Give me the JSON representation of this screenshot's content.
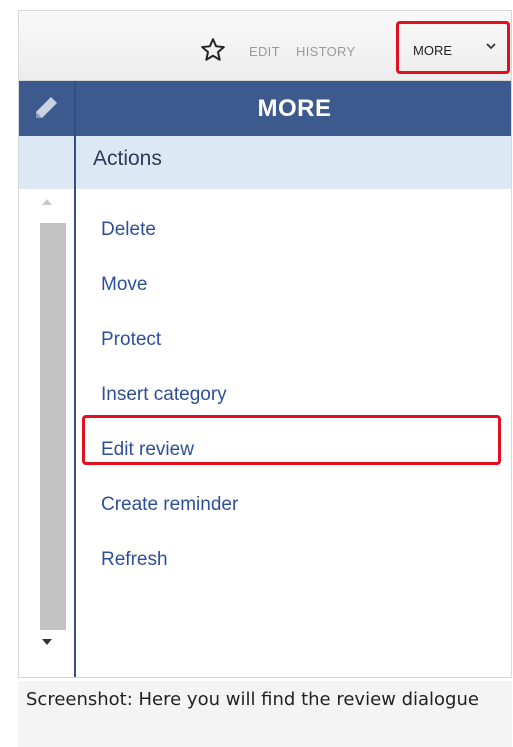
{
  "toolbar": {
    "star_icon": "star-outline-icon",
    "edit_label": "EDIT",
    "history_label": "HISTORY",
    "more_label": "MORE",
    "chevron_icon": "chevron-down-icon"
  },
  "panel": {
    "edit_icon": "pencil-icon",
    "title": "MORE",
    "header_color": "#3d5a8e",
    "section_label": "Actions",
    "items": [
      {
        "label": "Delete"
      },
      {
        "label": "Move"
      },
      {
        "label": "Protect"
      },
      {
        "label": "Insert category"
      },
      {
        "label": "Edit review",
        "highlighted": true
      },
      {
        "label": "Create reminder"
      },
      {
        "label": "Refresh"
      }
    ]
  },
  "highlight_color": "#e01020",
  "caption": "Screenshot: Here you will find the review dialogue"
}
